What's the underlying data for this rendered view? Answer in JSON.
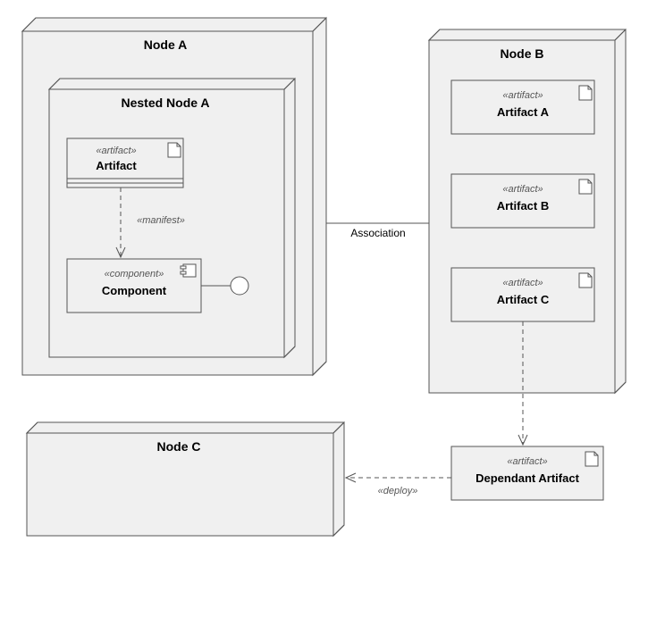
{
  "diagram": {
    "type": "UML Deployment Diagram",
    "nodes": {
      "nodeA": {
        "title": "Node A"
      },
      "nestedNodeA": {
        "title": "Nested Node A"
      },
      "nodeB": {
        "title": "Node B"
      },
      "nodeC": {
        "title": "Node C"
      }
    },
    "artifacts": {
      "artifact": {
        "stereotype": "«artifact»",
        "name": "Artifact"
      },
      "artifactA": {
        "stereotype": "«artifact»",
        "name": "Artifact A"
      },
      "artifactB": {
        "stereotype": "«artifact»",
        "name": "Artifact B"
      },
      "artifactC": {
        "stereotype": "«artifact»",
        "name": "Artifact C"
      },
      "dependant": {
        "stereotype": "«artifact»",
        "name": "Dependant Artifact"
      }
    },
    "component": {
      "stereotype": "«component»",
      "name": "Component"
    },
    "relations": {
      "manifest": {
        "label": "«manifest»"
      },
      "association": {
        "label": "Association"
      },
      "deploy": {
        "label": "«deploy»"
      }
    }
  }
}
